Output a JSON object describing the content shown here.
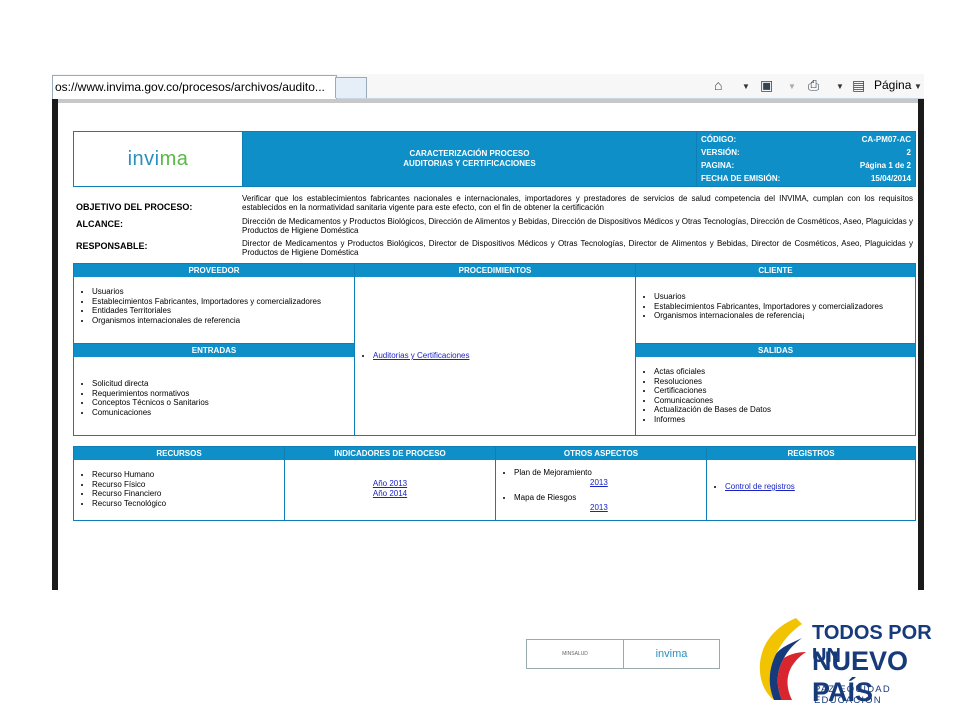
{
  "browser": {
    "tab_url": "os://www.invima.gov.co/procesos/archivos/audito...",
    "toolbar": {
      "page_label": "Página"
    }
  },
  "doc": {
    "header": {
      "logo_text": "invima",
      "title_line1": "CARACTERIZACIÓN PROCESO",
      "title_line2": "AUDITORIAS Y CERTIFICACIONES",
      "fields": [
        {
          "label": "CÓDIGO:",
          "value": "CA-PM07-AC"
        },
        {
          "label": "VERSIÓN:",
          "value": "2"
        },
        {
          "label": "PAGINA:",
          "value": "Página 1 de 2"
        },
        {
          "label": "FECHA DE EMISIÓN:",
          "value": "15/04/2014"
        }
      ]
    },
    "objetivo": {
      "label": "OBJETIVO DEL PROCESO:",
      "text": "Verificar que los establecimientos fabricantes nacionales e internacionales, importadores y prestadores de servicios de salud competencia del INVIMA, cumplan con los requisitos establecidos en la normatividad sanitaria vigente para este efecto, con el fin de obtener la certificación"
    },
    "alcance": {
      "label": "ALCANCE:",
      "text": "Dirección de Medicamentos y Productos Biológicos, Dirección de Alimentos y Bebidas, Dirección de Dispositivos Médicos y Otras Tecnologías, Dirección de Cosméticos, Aseo, Plaguicidas y Productos de Higiene Doméstica"
    },
    "responsable": {
      "label": "RESPONSABLE:",
      "text": "Director de Medicamentos y Productos Biológicos, Director de Dispositivos Médicos y Otras Tecnologías, Director de Alimentos y Bebidas, Director de Cosméticos, Aseo, Plaguicidas y Productos de Higiene Doméstica"
    },
    "proveedor": {
      "title": "PROVEEDOR",
      "items": [
        "Usuarios",
        "Establecimientos Fabricantes, Importadores y comercializadores",
        "Entidades Territoriales",
        "Organismos internacionales de referencia"
      ]
    },
    "procedimientos": {
      "title": "PROCEDIMIENTOS",
      "link": "Auditorias y Certificaciones"
    },
    "cliente": {
      "title": "CLIENTE",
      "items": [
        "Usuarios",
        "Establecimientos Fabricantes, Importadores y comercializadores",
        "Organismos internacionales de referencia¡"
      ]
    },
    "entradas": {
      "title": "ENTRADAS",
      "items": [
        "Solicitud directa",
        "Requerimientos normativos",
        "Conceptos Técnicos o Sanitarios",
        "Comunicaciones"
      ]
    },
    "salidas": {
      "title": "SALIDAS",
      "items": [
        "Actas oficiales",
        "Resoluciones",
        "Certificaciones",
        "Comunicaciones",
        "Actualización de Bases de Datos",
        "Informes"
      ]
    },
    "recursos": {
      "title": "RECURSOS",
      "items": [
        "Recurso Humano",
        "Recurso Físico",
        "Recurso Financiero",
        "Recurso Tecnológico"
      ]
    },
    "indicadores": {
      "title": "INDICADORES DE PROCESO",
      "links": [
        "Año 2013",
        "Año 2014"
      ]
    },
    "otros": {
      "title": "OTROS ASPECTOS",
      "plan_label": "Plan de Mejoramiento",
      "plan_link": "2013",
      "mapa_label": "Mapa de Riesgos",
      "mapa_link": "2013"
    },
    "registros": {
      "title": "REGISTROS",
      "link": "Control de registros"
    }
  },
  "footer": {
    "left_text": "MINSALUD",
    "right_text": "invima"
  },
  "gov": {
    "line1": "TODOS POR UN",
    "line2": "NUEVO PAÍS",
    "line3": "PAZ EQUIDAD EDUCACIÓN"
  },
  "colors": {
    "accent": "#0e8fc7",
    "link": "#1a23c4",
    "gov_navy": "#173a7a"
  }
}
